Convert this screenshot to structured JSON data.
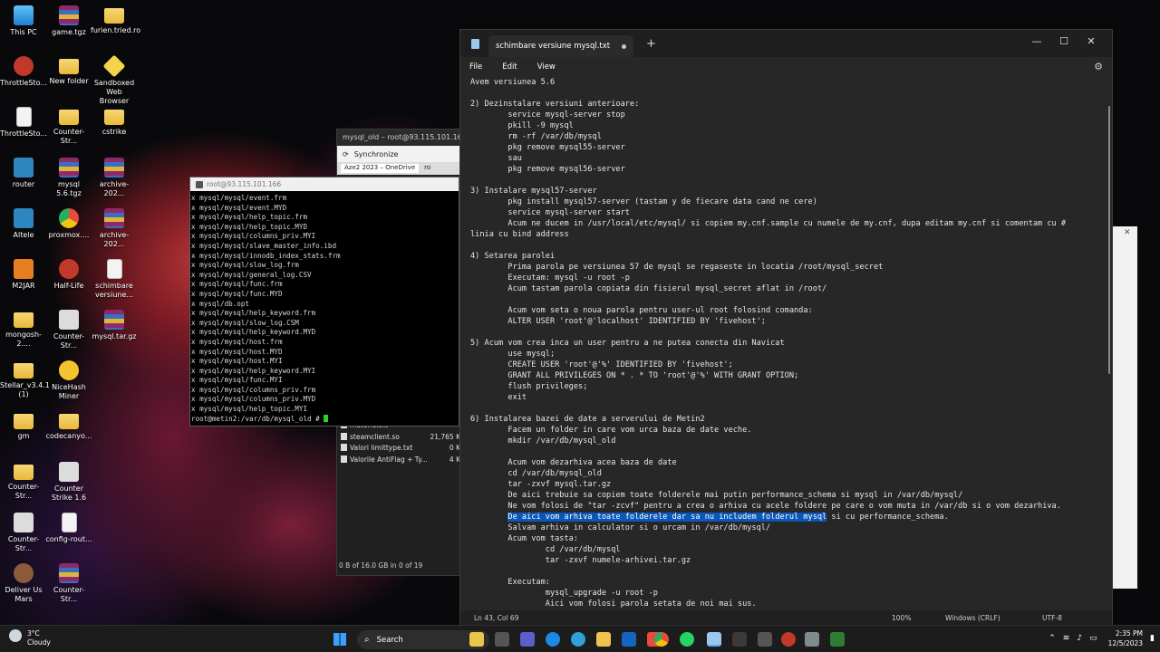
{
  "desktop": {
    "icons": [
      {
        "label": "This PC",
        "icon": "pc-icon"
      },
      {
        "label": "game.tgz",
        "icon": "archive-icon"
      },
      {
        "label": "furien.tried.ro",
        "icon": "folder-icon"
      },
      {
        "label": "ThrottleSto...",
        "icon": "app-icon"
      },
      {
        "label": "New folder",
        "icon": "folder-icon"
      },
      {
        "label": "Sandboxed Web Browser",
        "icon": "sandbox-icon"
      },
      {
        "label": "ThrottleSto...",
        "icon": "document-icon"
      },
      {
        "label": "Counter-Str...",
        "icon": "folder-icon"
      },
      {
        "label": "cstrike",
        "icon": "folder-icon"
      },
      {
        "label": "router",
        "icon": "router-icon"
      },
      {
        "label": "mysql 5.6.tgz",
        "icon": "archive-icon"
      },
      {
        "label": "archive-202...",
        "icon": "archive-icon"
      },
      {
        "label": "Altele",
        "icon": "router-icon"
      },
      {
        "label": "proxmox....",
        "icon": "chrome-icon"
      },
      {
        "label": "archive-202...",
        "icon": "archive-icon"
      },
      {
        "label": "M2JAR",
        "icon": "jar-icon"
      },
      {
        "label": "Half-Life",
        "icon": "app-icon"
      },
      {
        "label": "schimbare versiune...",
        "icon": "document-icon"
      },
      {
        "label": "mongosh-2....",
        "icon": "folder-icon"
      },
      {
        "label": "Counter-Str...",
        "icon": "counter-strike-icon"
      },
      {
        "label": "mysql.tar.gz",
        "icon": "archive-icon"
      },
      {
        "label": "Stellar_v3.4.1 (1)",
        "icon": "folder-icon"
      },
      {
        "label": "NiceHash Miner",
        "icon": "nicehash-icon"
      },
      {
        "label": "gm",
        "icon": "folder-icon"
      },
      {
        "label": "codecanyo...",
        "icon": "folder-icon"
      },
      {
        "label": "Counter-Str...",
        "icon": "folder-icon"
      },
      {
        "label": "Counter Strike 1.6",
        "icon": "counter-strike-icon"
      },
      {
        "label": "Counter-Str...",
        "icon": "counter-strike-icon"
      },
      {
        "label": "config-rout...",
        "icon": "document-icon"
      },
      {
        "label": "Deliver Us Mars",
        "icon": "mars-icon"
      },
      {
        "label": "Counter-Str...",
        "icon": "archive-icon"
      }
    ]
  },
  "explorer": {
    "title": "mysql_old – root@93.115.101.166",
    "toolbar_label": "Synchronize",
    "tabs": [
      "Aze2 2023 – OneDrive",
      "ro"
    ],
    "files": [
      {
        "name": "steamclient.so",
        "size": "21,765 K"
      },
      {
        "name": "Valori limittype.txt",
        "size": "0 K"
      },
      {
        "name": "Valorile AntiFlag + Ty...",
        "size": "4 K"
      }
    ],
    "partial_file": "materie.txt",
    "status": "0 B of 16.0 GB in 0 of 19"
  },
  "terminal": {
    "title": "root@93.115.101.166",
    "lines": [
      "x mysql/mysql/event.frm",
      "x mysql/mysql/event.MYD",
      "x mysql/mysql/help_topic.frm",
      "x mysql/mysql/help_topic.MYD",
      "x mysql/mysql/columns_priv.MYI",
      "x mysql/mysql/slave_master_info.ibd",
      "x mysql/mysql/innodb_index_stats.frm",
      "x mysql/mysql/slow_log.frm",
      "x mysql/mysql/general_log.CSV",
      "x mysql/mysql/func.frm",
      "x mysql/mysql/func.MYD",
      "x mysql/db.opt",
      "x mysql/mysql/help_keyword.frm",
      "x mysql/mysql/slow_log.CSM",
      "x mysql/mysql/help_keyword.MYD",
      "x mysql/mysql/host.frm",
      "x mysql/mysql/host.MYD",
      "x mysql/mysql/host.MYI",
      "x mysql/mysql/help_keyword.MYI",
      "x mysql/mysql/func.MYI",
      "x mysql/mysql/columns_priv.frm",
      "x mysql/mysql/columns_priv.MYD",
      "x mysql/mysql/help_topic.MYI"
    ],
    "prompt": "root@metin2:/var/db/mysql_old # "
  },
  "notepad": {
    "tab_title": "schimbare versiune mysql.txt",
    "menu": [
      "File",
      "Edit",
      "View"
    ],
    "lines": [
      {
        "text": "Avem versiunea 5.6"
      },
      {
        "text": ""
      },
      {
        "text": "2) Dezinstalare versiuni anterioare:"
      },
      {
        "text": "        service mysql-server stop"
      },
      {
        "text": "        pkill -9 mysql"
      },
      {
        "text": "        rm -rf /var/db/mysql"
      },
      {
        "text": "        pkg remove mysql55-server"
      },
      {
        "text": "        sau"
      },
      {
        "text": "        pkg remove mysql56-server"
      },
      {
        "text": ""
      },
      {
        "text": "3) Instalare mysql57-server"
      },
      {
        "text": "        pkg install mysql57-server (tastam y de fiecare data cand ne cere)"
      },
      {
        "text": "        service mysql-server start"
      },
      {
        "text": "        Acum ne ducem in /usr/local/etc/mysql/ si copiem my.cnf.sample cu numele de my.cnf, dupa editam my.cnf si comentam cu #"
      },
      {
        "text": "linia cu bind address"
      },
      {
        "text": ""
      },
      {
        "text": "4) Setarea parolei"
      },
      {
        "text": "        Prima parola pe versiunea 57 de mysql se regaseste in locatia /root/mysql_secret"
      },
      {
        "text": "        Executam: mysql -u root -p"
      },
      {
        "text": "        Acum tastam parola copiata din fisierul mysql_secret aflat in /root/"
      },
      {
        "text": ""
      },
      {
        "text": "        Acum vom seta o noua parola pentru user-ul root folosind comanda:"
      },
      {
        "text": "        ALTER USER 'root'@'localhost' IDENTIFIED BY 'fivehost';"
      },
      {
        "text": ""
      },
      {
        "text": "5) Acum vom crea inca un user pentru a ne putea conecta din Navicat"
      },
      {
        "text": "        use mysql;"
      },
      {
        "text": "        CREATE USER 'root'@'%' IDENTIFIED BY 'fivehost';"
      },
      {
        "text": "        GRANT ALL PRIVILEGES ON * . * TO 'root'@'%' WITH GRANT OPTION;"
      },
      {
        "text": "        flush privileges;"
      },
      {
        "text": "        exit"
      },
      {
        "text": ""
      },
      {
        "text": "6) Instalarea bazei de date a serverului de Metin2"
      },
      {
        "text": "        Facem un folder in care vom urca baza de date veche."
      },
      {
        "text": "        mkdir /var/db/mysql_old"
      },
      {
        "text": ""
      },
      {
        "text": "        Acum vom dezarhiva acea baza de date"
      },
      {
        "text": "        cd /var/db/mysql_old"
      },
      {
        "text": "        tar -zxvf mysql.tar.gz"
      },
      {
        "text": "        De aici trebuie sa copiem toate folderele mai putin performance_schema si mysql in /var/db/mysql/"
      },
      {
        "text": "        Ne vom folosi de \"tar -zcvf\" pentru a crea o arhiva cu acele foldere pe care o vom muta in /var/db si o vom dezarhiva."
      },
      {
        "text": "        ",
        "selected": "De aici vom arhiva toate folderele dar sa nu includem folderul mysql",
        "after": " si cu performance_schema."
      },
      {
        "text": "        Salvam arhiva in calculator si o urcam in /var/db/mysql/"
      },
      {
        "text": "        Acum vom tasta:"
      },
      {
        "text": "                cd /var/db/mysql"
      },
      {
        "text": "                tar -zxvf numele-arhivei.tar.gz"
      },
      {
        "text": ""
      },
      {
        "text": "        Executam:"
      },
      {
        "text": "                mysql_upgrade -u root -p"
      },
      {
        "text": "                Aici vom folosi parola setata de noi mai sus."
      }
    ],
    "status": {
      "position": "Ln 43, Col 69",
      "zoom": "100%",
      "line_ending": "Windows (CRLF)",
      "encoding": "UTF-8"
    }
  },
  "taskbar": {
    "weather_temp": "3°C",
    "weather_desc": "Cloudy",
    "search_label": "Search",
    "time": "2:35 PM",
    "date": "12/5/2023"
  },
  "colors": {
    "selection": "#0b57b9",
    "notepad_bg": "#272727",
    "terminal_cursor": "#22d822"
  }
}
